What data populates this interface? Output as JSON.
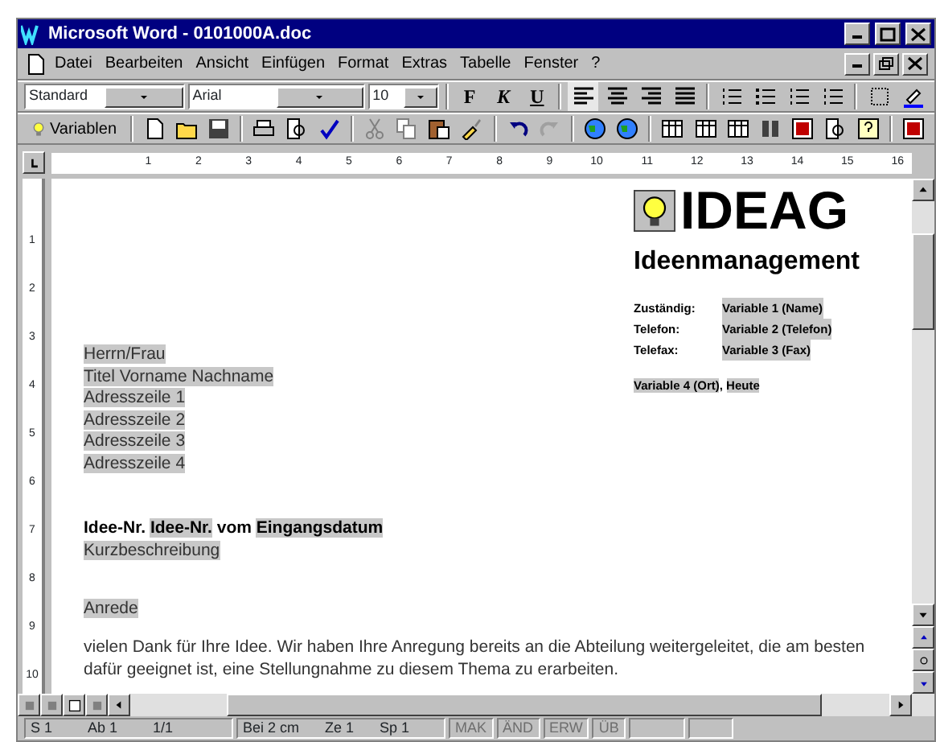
{
  "window": {
    "title": "Microsoft Word - 0101000A.doc"
  },
  "menu": [
    "Datei",
    "Bearbeiten",
    "Ansicht",
    "Einfügen",
    "Format",
    "Extras",
    "Tabelle",
    "Fenster",
    "?"
  ],
  "format_toolbar": {
    "style": "Standard",
    "font": "Arial",
    "size": "10",
    "text_buttons": [
      {
        "label": "F",
        "kind": "bold"
      },
      {
        "label": "K",
        "kind": "italic"
      },
      {
        "label": "U",
        "kind": "underline"
      }
    ]
  },
  "standard_toolbar": {
    "variables_button": "Variablen"
  },
  "ruler": {
    "horizontal": [
      "1",
      "2",
      "3",
      "4",
      "5",
      "6",
      "7",
      "8",
      "9",
      "10",
      "11",
      "12",
      "13",
      "14",
      "15",
      "16"
    ],
    "vertical": [
      "1",
      "2",
      "3",
      "4",
      "5",
      "6",
      "7",
      "8",
      "9",
      "10"
    ]
  },
  "document": {
    "logo": "IDEAG",
    "subtitle": "Ideenmanagement",
    "contacts": [
      {
        "label": "Zuständig:",
        "value": "Variable 1 (Name)"
      },
      {
        "label": "Telefon:",
        "value": "Variable 2 (Telefon)"
      },
      {
        "label": "Telefax:",
        "value": "Variable 3 (Fax)"
      }
    ],
    "date_line": [
      {
        "text": "Variable 4 (Ort)",
        "field": true
      },
      {
        "text": ", ",
        "field": false
      },
      {
        "text": "Heute",
        "field": true
      }
    ],
    "address": [
      "Herrn/Frau",
      "Titel Vorname Nachname",
      "Adresszeile 1",
      "Adresszeile 2",
      "Adresszeile 3",
      "Adresszeile 4"
    ],
    "subject": [
      {
        "text": "Idee-Nr. ",
        "field": false
      },
      {
        "text": "Idee-Nr.",
        "field": true
      },
      {
        "text": " vom ",
        "field": false
      },
      {
        "text": "Eingangsdatum",
        "field": true
      }
    ],
    "summary": "Kurzbeschreibung",
    "salutation": "Anrede",
    "body": "vielen Dank für Ihre Idee. Wir haben Ihre Anregung bereits an die Abteilung weitergeleitet, die am besten dafür geeignet ist, eine Stellungnahme zu diesem Thema zu erarbeiten."
  },
  "status_bar": {
    "items": [
      "S 1",
      "Ab 1",
      "1/1",
      "Bei 2 cm",
      "Ze 1",
      "Sp 1"
    ],
    "modes": [
      {
        "label": "MAK",
        "disabled": true
      },
      {
        "label": "ÄND",
        "disabled": true
      },
      {
        "label": "ERW",
        "disabled": true
      },
      {
        "label": "ÜB",
        "disabled": true
      }
    ]
  }
}
